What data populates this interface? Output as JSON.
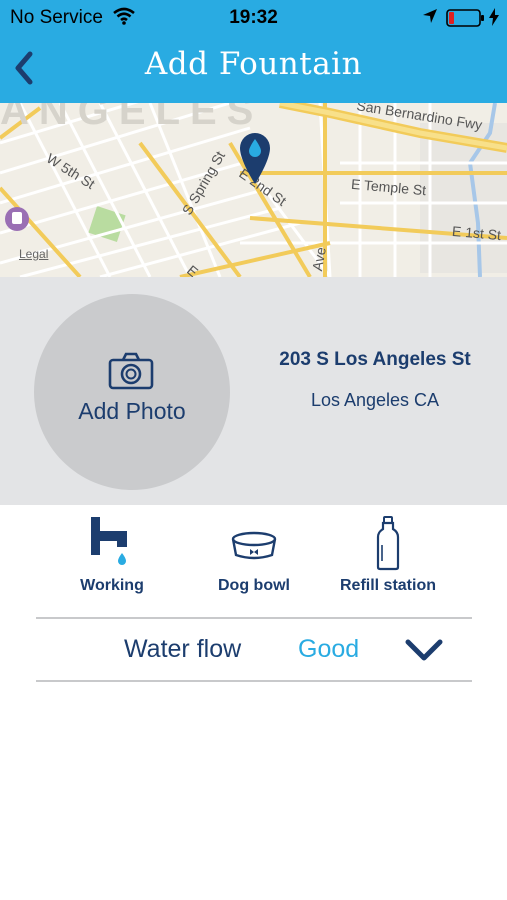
{
  "status_bar": {
    "carrier": "No Service",
    "time": "19:32"
  },
  "nav": {
    "title": "Add Fountain"
  },
  "map": {
    "city_label": "ANGELES",
    "streets": [
      "San Bernardino Fwy",
      "W 5th St",
      "S Spring St",
      "E 2nd St",
      "E Temple St",
      "E 1st St",
      "Ave",
      "E"
    ],
    "legal": "Legal"
  },
  "photo": {
    "label": "Add Photo"
  },
  "address": {
    "line1": "203 S Los Angeles St",
    "line2": "Los Angeles CA"
  },
  "features": [
    {
      "label": "Working",
      "icon": "faucet-icon"
    },
    {
      "label": "Dog bowl",
      "icon": "dog-bowl-icon"
    },
    {
      "label": "Refill station",
      "icon": "bottle-icon"
    }
  ],
  "water_flow": {
    "label": "Water flow",
    "value": "Good"
  },
  "colors": {
    "accent": "#29abe2",
    "navy": "#1c3d6e",
    "info_bg": "#e3e4e6"
  }
}
